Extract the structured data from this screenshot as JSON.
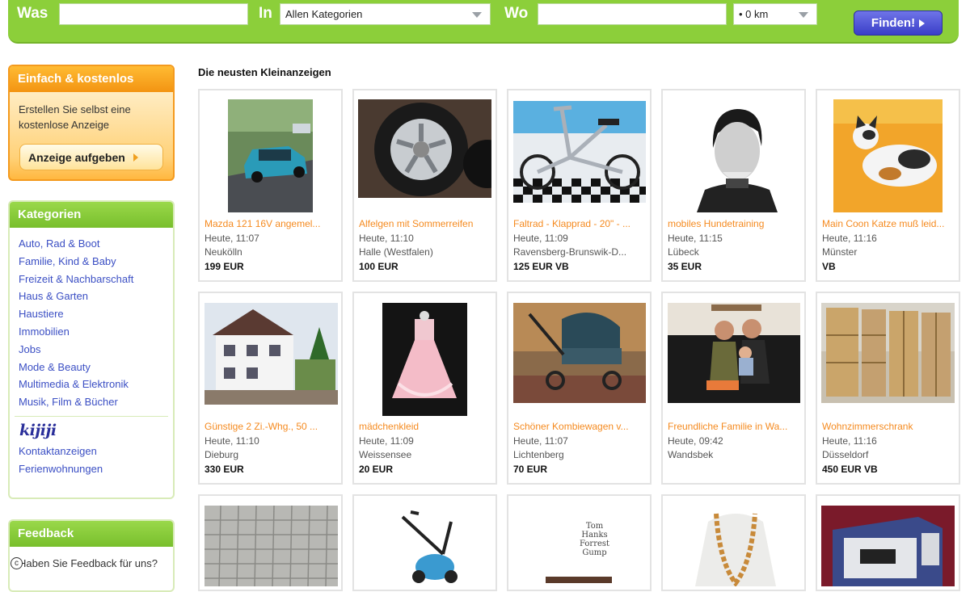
{
  "search": {
    "was_label": "Was",
    "was_value": "",
    "in_label": "In",
    "category_selected": "Allen Kategorien",
    "wo_label": "Wo",
    "wo_value": "",
    "radius_selected": "• 0 km",
    "find_label": "Finden!"
  },
  "promo": {
    "title": "Einfach & kostenlos",
    "text": "Erstellen Sie selbst eine kostenlose Anzeige",
    "button": "Anzeige aufgeben"
  },
  "categories": {
    "title": "Kategorien",
    "items": [
      "Auto, Rad & Boot",
      "Familie, Kind & Baby",
      "Freizeit & Nachbarschaft",
      "Haus & Garten",
      "Haustiere",
      "Immobilien",
      "Jobs",
      "Mode & Beauty",
      "Multimedia & Elektronik",
      "Musik, Film & Bücher"
    ],
    "logo": "kijiji",
    "extra": [
      "Kontaktanzeigen",
      "Ferienwohnungen"
    ]
  },
  "feedback": {
    "title": "Feedback",
    "text": "Haben Sie Feedback für uns?"
  },
  "main": {
    "title": "Die neusten Kleinanzeigen",
    "listings": [
      {
        "title": "Mazda 121 16V  angemel...",
        "date": "Heute, 11:07",
        "location": "Neukölln",
        "price": "199 EUR"
      },
      {
        "title": "Alfelgen mit Sommerreifen",
        "date": "Heute, 11:10",
        "location": "Halle (Westfalen)",
        "price": "100 EUR"
      },
      {
        "title": "Faltrad - Klapprad - 20\" - ...",
        "date": "Heute, 11:09",
        "location": "Ravensberg-Brunswik-D...",
        "price": "125 EUR VB"
      },
      {
        "title": "mobiles Hundetraining",
        "date": "Heute, 11:15",
        "location": "Lübeck",
        "price": "35 EUR"
      },
      {
        "title": "Main Coon Katze muß leid...",
        "date": "Heute, 11:16",
        "location": "Münster",
        "price": "VB"
      },
      {
        "title": "Günstige 2 Zi.-Whg., 50 ...",
        "date": "Heute, 11:10",
        "location": "Dieburg",
        "price": "330 EUR"
      },
      {
        "title": "mädchenkleid",
        "date": "Heute, 11:09",
        "location": "Weissensee",
        "price": "20 EUR"
      },
      {
        "title": "Schöner Kombiewagen v...",
        "date": "Heute, 11:07",
        "location": "Lichtenberg",
        "price": "70 EUR"
      },
      {
        "title": "Freundliche Familie in Wa...",
        "date": "Heute, 09:42",
        "location": "Wandsbek",
        "price": ""
      },
      {
        "title": "Wohnzimmerschrank",
        "date": "Heute, 11:16",
        "location": "Düsseldorf",
        "price": "450 EUR VB"
      }
    ],
    "poster_text": [
      "Tom",
      "Hanks",
      "Forrest",
      "Gump"
    ]
  },
  "colors": {
    "brand_green": "#8ccf3a",
    "accent_orange": "#f58a1f",
    "link_blue": "#3b4fc4",
    "button_blue": "#3a3fc8"
  }
}
